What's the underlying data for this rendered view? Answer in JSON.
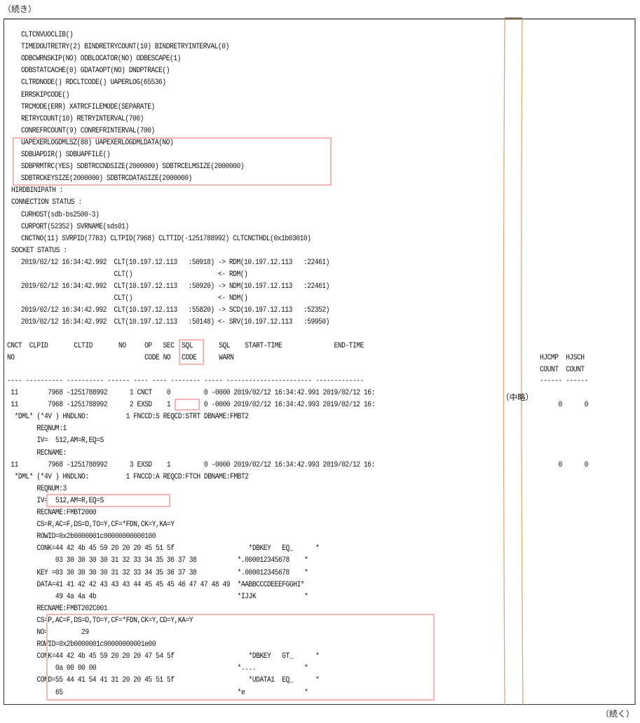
{
  "captions": {
    "top": "（続き）",
    "bottom": "（続く）",
    "omitted": "（中略）"
  },
  "colors": {
    "highlight": "#f5b5b8",
    "break_line": "#d9a36a",
    "frame": "#333333"
  },
  "config_lines": [
    "CLTCNVUOCLIB()",
    "TIMEDOUTRETRY(2) BINDRETRYCOUNT(10) BINDRETRYINTERVAL(0)",
    "ODBCWRNSKIP(NO) ODBLOCATOR(NO) ODBESCAPE(1)",
    "ODBSTATCACHE(0) GDATAOPT(NO) DNDPTRACE()",
    "CLTRDNODE() RDCLTCODE() UAPERLOG(65536)",
    "ERRSKIPCODE()",
    "TRCMODE(ERR) XATRCFILEMODE(SEPARATE)",
    "RETRYCOUNT(10) RETRYINTERVAL(700)",
    "CONREFRCOUNT(9) CONREFRINTERVAL(700)",
    "UAPEXERLOGDMLSZ(80) UAPEXERLOGDMLDATA(NO)",
    "SDBUAPDIR() SDBUAPFILE()",
    "SDBPRMTRC(YES) SDBTRCCNDSIZE(2000000) SDBTRCELMSIZE(2000000)",
    "SDBTRCKEYSIZE(2000000) SDBTRCDATASIZE(2000000)"
  ],
  "hirdbinipath": "HIRDBINIPATH :",
  "connection_status": {
    "label": "CONNECTION STATUS :",
    "lines": [
      "CURHOST(sdb-bs2500-3)",
      "CURPORT(52352) SVRNAME(sds01)",
      "CNCTNO(11) SVRPID(7763) CLTPID(7968) CLTTID(-1251788992) CLTCNCTHDL(0x1b03010)"
    ]
  },
  "socket_status": {
    "label": "SOCKET STATUS :",
    "lines": [
      "2019/02/12 16:34:42.992  CLT(10.197.12.113   :50918) -> RDM(10.197.12.113   :22461)",
      "                         CLT()                       <- RDM()",
      "2019/02/12 16:34:42.992  CLT(10.197.12.113   :50920) -> NDM(10.197.12.113   :22461)",
      "                         CLT()                       <- NDM()",
      "2019/02/12 16:34:42.992  CLT(10.197.12.113   :55820) -> SCD(10.197.12.113   :52352)",
      "2019/02/12 16:34:42.992  CLT(10.197.12.113   :50148) <- SRV(10.197.12.113   :59950)"
    ]
  },
  "table": {
    "header1": "CNCT  CLPID       CLTID       NO     OP   SEC  SQL       SQL    START-TIME              END-TIME",
    "header2": "NO                                   CODE NO   CODE      WARN",
    "right_header1": "HJCMP  HJSCH",
    "right_header2": "COUNT  COUNT",
    "separator": "---- ---------- ---------- ------ ---- ---- -------- ----- ----------------------- -------------",
    "right_separator": "------ ------",
    "rows": [
      {
        "text": " 11        7968 -1251788992      1 CNCT    0         0 -0000 2019/02/12 16:34:42.991 2019/02/12 16:",
        "right": ""
      },
      {
        "text": " 11        7968 -1251788992      2 EXSD    1         0 -0000 2019/02/12 16:34:42.993 2019/02/12 16:",
        "right": "     0      0"
      }
    ],
    "detail1": [
      "  *DML* (*4V ) HNDLNO:          1 FNCCD:S REQCD:STRT DBNAME:FMBT2",
      "        REQNUM:1",
      "        IV=  512,AM=R,EQ=S",
      "        RECNAME:"
    ],
    "row3": {
      "text": " 11        7968 -1251788992      3 EXSD    1         0 -0000 2019/02/12 16:34:42.993 2019/02/12 16:",
      "right": "     0      0"
    },
    "detail2": [
      "  *DML* (*4V ) HNDLNO:          1 FNCCD:A REQCD:FTCH DBNAME:FMBT2",
      "        REQNUM:3",
      "        IV=  512,AM=R,EQ=S",
      "        RECNAME:FMBT2000",
      "        CS=R,AC=F,DS=D,TO=Y,CF=*FDN,CK=Y,KA=Y",
      "        ROWID=0x2b0000001c00000000000100",
      "        CONK=44 42 4b 45 59 20 20 20 45 51 5f                    *DBKEY   EQ_      *",
      "             03 30 30 30 30 31 32 33 34 35 36 37 38           *.000012345678    *",
      "        KEY =03 30 30 30 30 31 32 33 34 35 36 37 38           *.000012345678    *",
      "        DATA=41 41 42 42 43 43 43 44 45 45 45 46 47 47 48 49  *AABBCCCDEEEFGGHI*",
      "             49 4a 4a 4b                                      *IJJK             *",
      "        RECNAME:FMBT202C001",
      "        CS=P,AC=F,DS=D,TO=Y,CF=*FDN,CK=Y,CD=Y,KA=Y",
      "        NO=         29",
      "        ROWID=0x2b0000001c00000000001e00",
      "        CONK=44 42 4b 45 59 20 20 20 47 54 5f                    *DBKEY   GT_      *",
      "             0a 00 00 00                                      *....             *",
      "        COND=55 44 41 54 41 31 20 20 45 51 5f                    *UDATA1  EQ_      *",
      "             65                                               *e                *"
    ]
  }
}
